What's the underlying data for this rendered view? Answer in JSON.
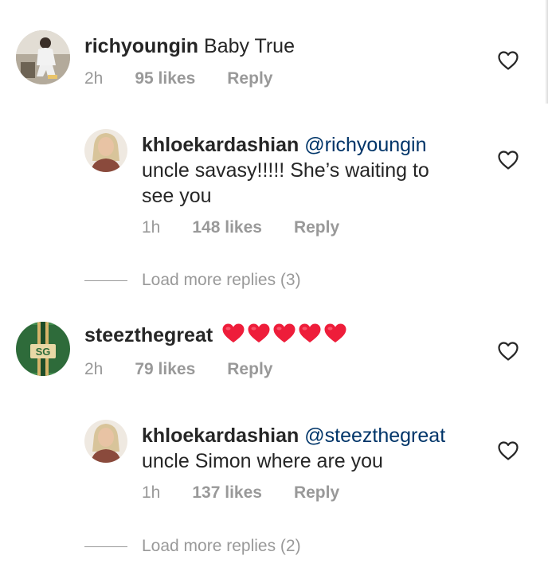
{
  "comments": [
    {
      "username": "richyoungin",
      "text": "Baby True",
      "time": "2h",
      "likes": "95 likes",
      "reply": "Reply",
      "replies": [
        {
          "username": "khloekardashian",
          "mention": "@richyoungin",
          "text_line1": "uncle savasy!!!!! She’s waiting to",
          "text_line2": "see you",
          "time": "1h",
          "likes": "148 likes",
          "reply": "Reply"
        }
      ],
      "load_more": "Load more replies (3)"
    },
    {
      "username": "steezthegreat",
      "avatar_initials": "SG",
      "text": "",
      "emoji": [
        "red-heart",
        "red-heart",
        "red-heart",
        "red-heart",
        "red-heart"
      ],
      "time": "2h",
      "likes": "79 likes",
      "reply": "Reply",
      "replies": [
        {
          "username": "khloekardashian",
          "mention": "@steezthegreat",
          "text_line1": "uncle Simon where are you",
          "time": "1h",
          "likes": "137 likes",
          "reply": "Reply"
        }
      ],
      "load_more": "Load more replies (2)"
    }
  ],
  "colors": {
    "text": "#262626",
    "muted": "#999999",
    "mention": "#003569",
    "heart_emoji": "#ee1d3a"
  }
}
